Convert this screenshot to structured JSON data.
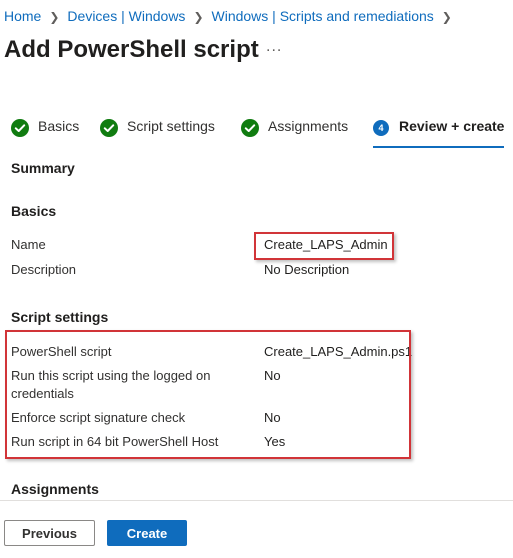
{
  "breadcrumb": [
    "Home",
    "Devices | Windows",
    "Windows | Scripts and remediations"
  ],
  "page_title": "Add PowerShell script",
  "more_icon": "...",
  "tabs": [
    {
      "label": "Basics",
      "state": "complete"
    },
    {
      "label": "Script settings",
      "state": "complete"
    },
    {
      "label": "Assignments",
      "state": "complete"
    },
    {
      "label": "Review + create",
      "state": "active",
      "step": "4"
    }
  ],
  "summary_heading": "Summary",
  "basics": {
    "heading": "Basics",
    "rows": [
      {
        "label": "Name",
        "value": "Create_LAPS_Admin"
      },
      {
        "label": "Description",
        "value": "No Description"
      }
    ]
  },
  "script_settings": {
    "heading": "Script settings",
    "rows": [
      {
        "label": "PowerShell script",
        "value": "Create_LAPS_Admin.ps1"
      },
      {
        "label": "Run this script using the logged on credentials",
        "value": "No"
      },
      {
        "label": "Enforce script signature check",
        "value": "No"
      },
      {
        "label": "Run script in 64 bit PowerShell Host",
        "value": "Yes"
      }
    ]
  },
  "assignments_heading": "Assignments",
  "buttons": {
    "previous": "Previous",
    "create": "Create"
  },
  "colors": {
    "accent": "#0f6cbd",
    "success": "#107c10",
    "highlight": "#d13438"
  }
}
